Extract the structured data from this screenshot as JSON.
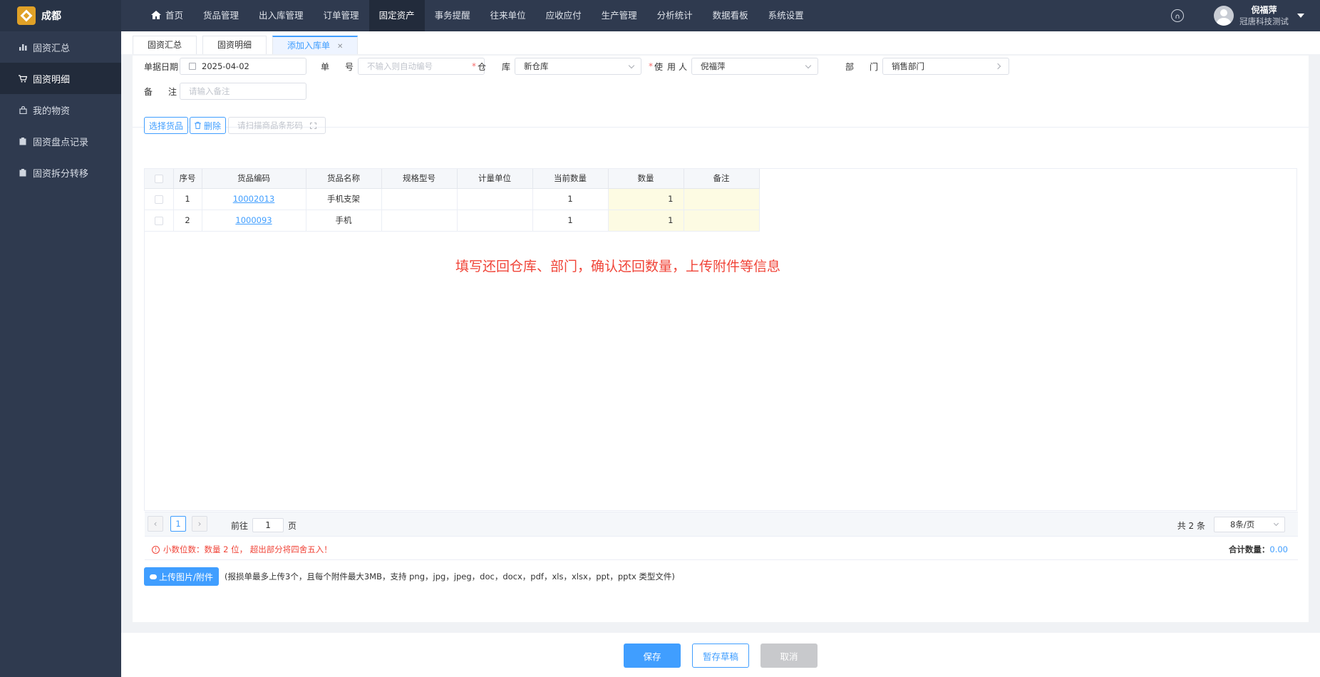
{
  "app": {
    "title": "成都"
  },
  "sidebar": {
    "items": [
      {
        "label": "固资汇总",
        "icon": "bar-chart-icon"
      },
      {
        "label": "固资明细",
        "icon": "cart-icon"
      },
      {
        "label": "我的物资",
        "icon": "bag-icon"
      },
      {
        "label": "固资盘点记录",
        "icon": "clipboard-icon"
      },
      {
        "label": "固资拆分转移",
        "icon": "clipboard-icon"
      }
    ],
    "active_index": 1
  },
  "nav": {
    "items": [
      "首页",
      "货品管理",
      "出入库管理",
      "订单管理",
      "固定资产",
      "事务提醒",
      "往来单位",
      "应收应付",
      "生产管理",
      "分析统计",
      "数据看板",
      "系统设置"
    ],
    "active_index": 4
  },
  "user": {
    "name": "倪福萍",
    "company": "冠唐科技测试"
  },
  "tabs": [
    {
      "label": "固资汇总"
    },
    {
      "label": "固资明细"
    },
    {
      "label": "添加入库单",
      "closable": true
    }
  ],
  "form": {
    "date_label": "单据日期",
    "date_value": "2025-04-02",
    "no_label_1": "单",
    "no_label_2": "号",
    "no_placeholder": "不输入则自动编号",
    "warehouse_label_1": "仓",
    "warehouse_label_2": "库",
    "warehouse_value": "新仓库",
    "user_label_1": "使",
    "user_label_2": "用",
    "user_label_3": "人",
    "user_value": "倪福萍",
    "dept_label_1": "部",
    "dept_label_2": "门",
    "dept_value": "销售部门",
    "remark_label_1": "备",
    "remark_label_2": "注",
    "remark_placeholder": "请输入备注",
    "required_mark": "*"
  },
  "toolbar": {
    "select_goods": "选择货品",
    "delete": "删除",
    "scan_placeholder": "请扫描商品条形码"
  },
  "table": {
    "headers": [
      "序号",
      "货品编码",
      "货品名称",
      "规格型号",
      "计量单位",
      "当前数量",
      "数量",
      "备注"
    ],
    "rows": [
      {
        "seq": "1",
        "code": "10002013",
        "name": "手机支架",
        "spec": "",
        "unit": "",
        "current": "1",
        "qty": "1",
        "remark": ""
      },
      {
        "seq": "2",
        "code": "1000093",
        "name": "手机",
        "spec": "",
        "unit": "",
        "current": "1",
        "qty": "1",
        "remark": ""
      }
    ]
  },
  "annotation": "填写还回仓库、部门，确认还回数量，上传附件等信息",
  "pager": {
    "prev": "‹",
    "next": "›",
    "current_page": "1",
    "goto_label": "前往",
    "goto_value": "1",
    "page_suffix": "页",
    "total": "共 2 条",
    "page_size": "8条/页"
  },
  "warning": {
    "text": "小数位数：数量 2 位，  超出部分将四舍五入！",
    "sum_label": "合计数量：",
    "sum_value": "0.00"
  },
  "upload": {
    "button": "上传图片/附件",
    "tip": "(报损单最多上传3个，且每个附件最大3MB，支持 png，jpg，jpeg，doc，docx，pdf，xls，xlsx，ppt，pptx 类型文件)"
  },
  "footer": {
    "save": "保存",
    "draft": "暂存草稿",
    "cancel": "取消"
  },
  "colors": {
    "accent": "#409eff",
    "sidebar": "#2f3a4f",
    "annotation": "#f04438",
    "qty_highlight": "#fdfbe3"
  }
}
